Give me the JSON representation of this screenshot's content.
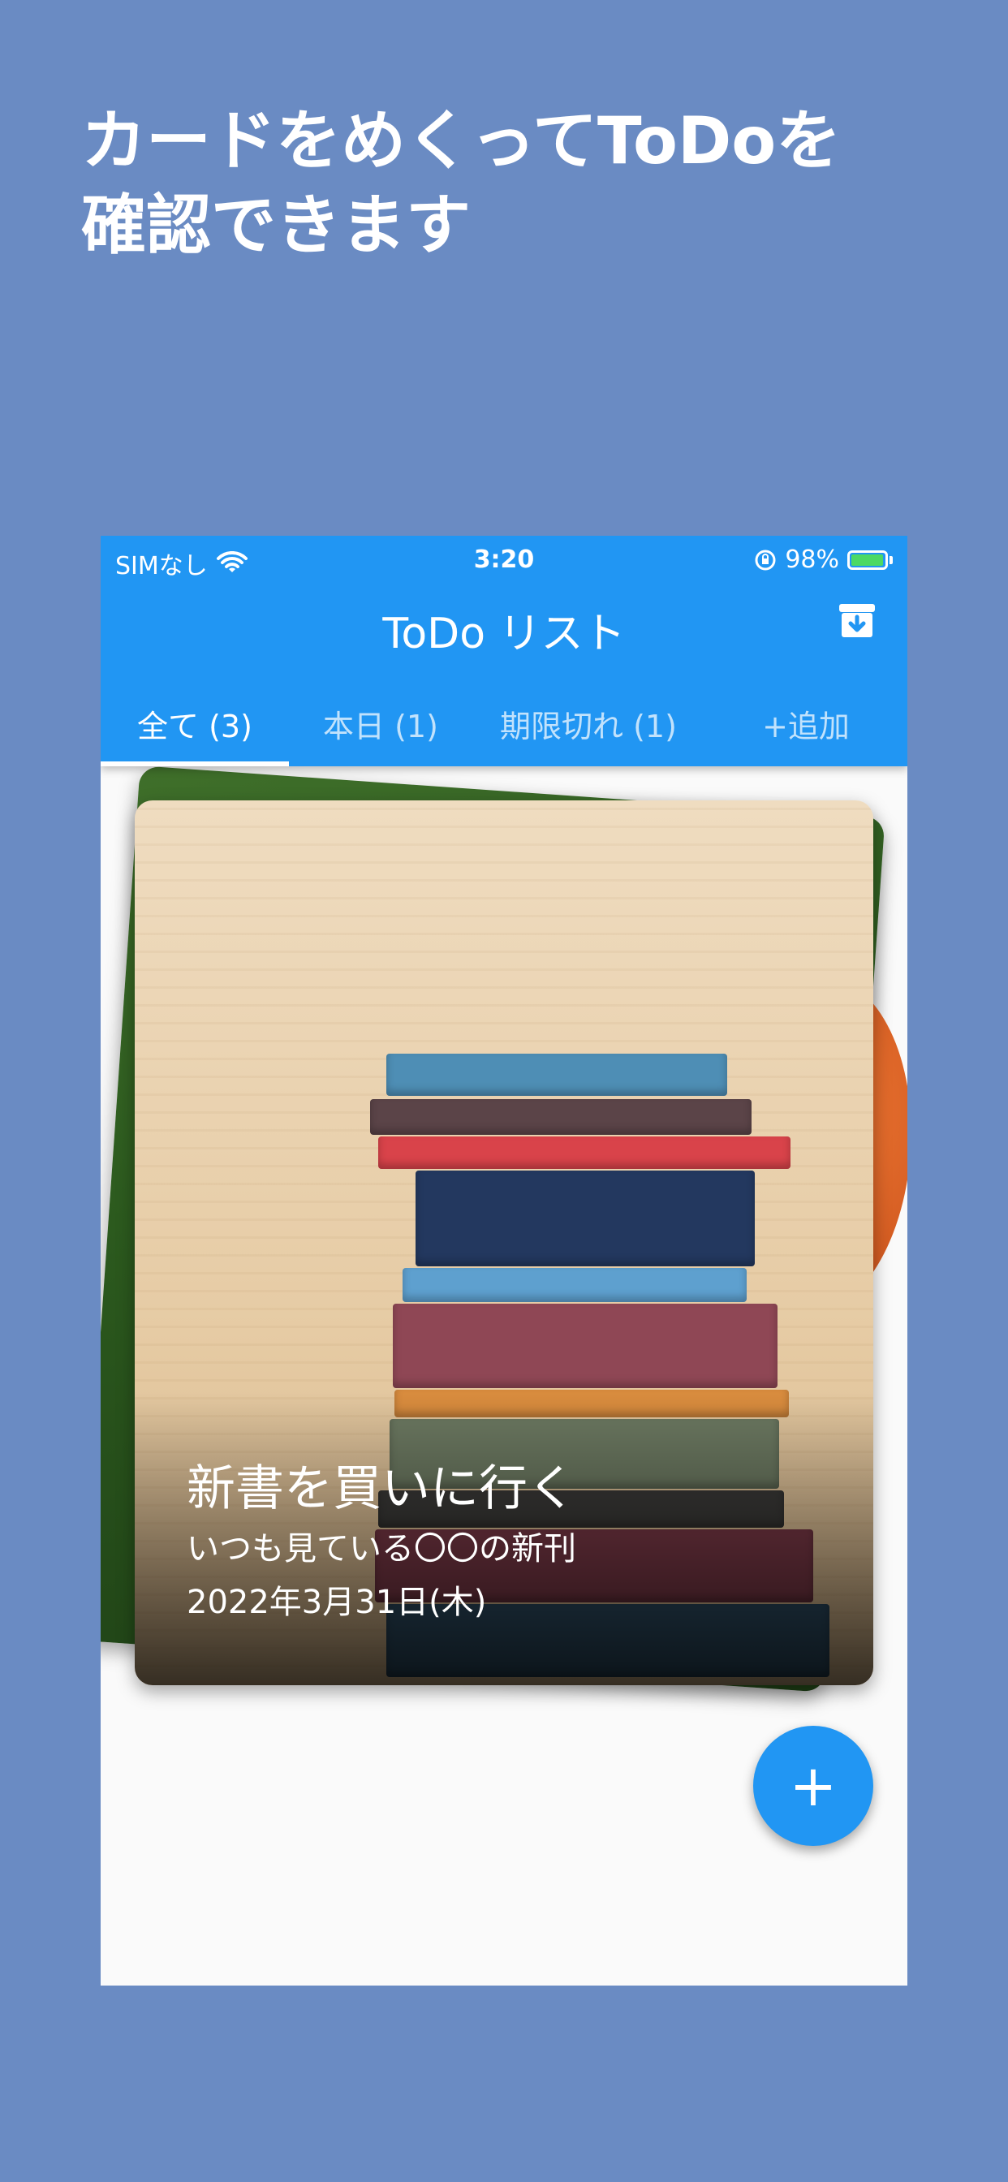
{
  "headline": {
    "line1": "カードをめくってToDoを",
    "line2": "確認できます"
  },
  "status_bar": {
    "carrier": "SIMなし",
    "time": "3:20",
    "battery": "98%",
    "battery_level": 0.98
  },
  "app_bar": {
    "title": "ToDo リスト",
    "archive_icon": "archive-download-icon"
  },
  "tabs": [
    {
      "label": "全て (3)",
      "active": true
    },
    {
      "label": "本日 (1)",
      "active": false
    },
    {
      "label": "期限切れ (1)",
      "active": false
    },
    {
      "label": "+追加",
      "active": false
    }
  ],
  "card": {
    "title": "新書を買いに行く",
    "subtitle": "いつも見ている〇〇の新刊",
    "date": "2022年3月31日(木)"
  },
  "fab": {
    "label": "+"
  },
  "colors": {
    "background": "#6a8bc3",
    "primary": "#2196f3",
    "surface": "#fafafa"
  }
}
